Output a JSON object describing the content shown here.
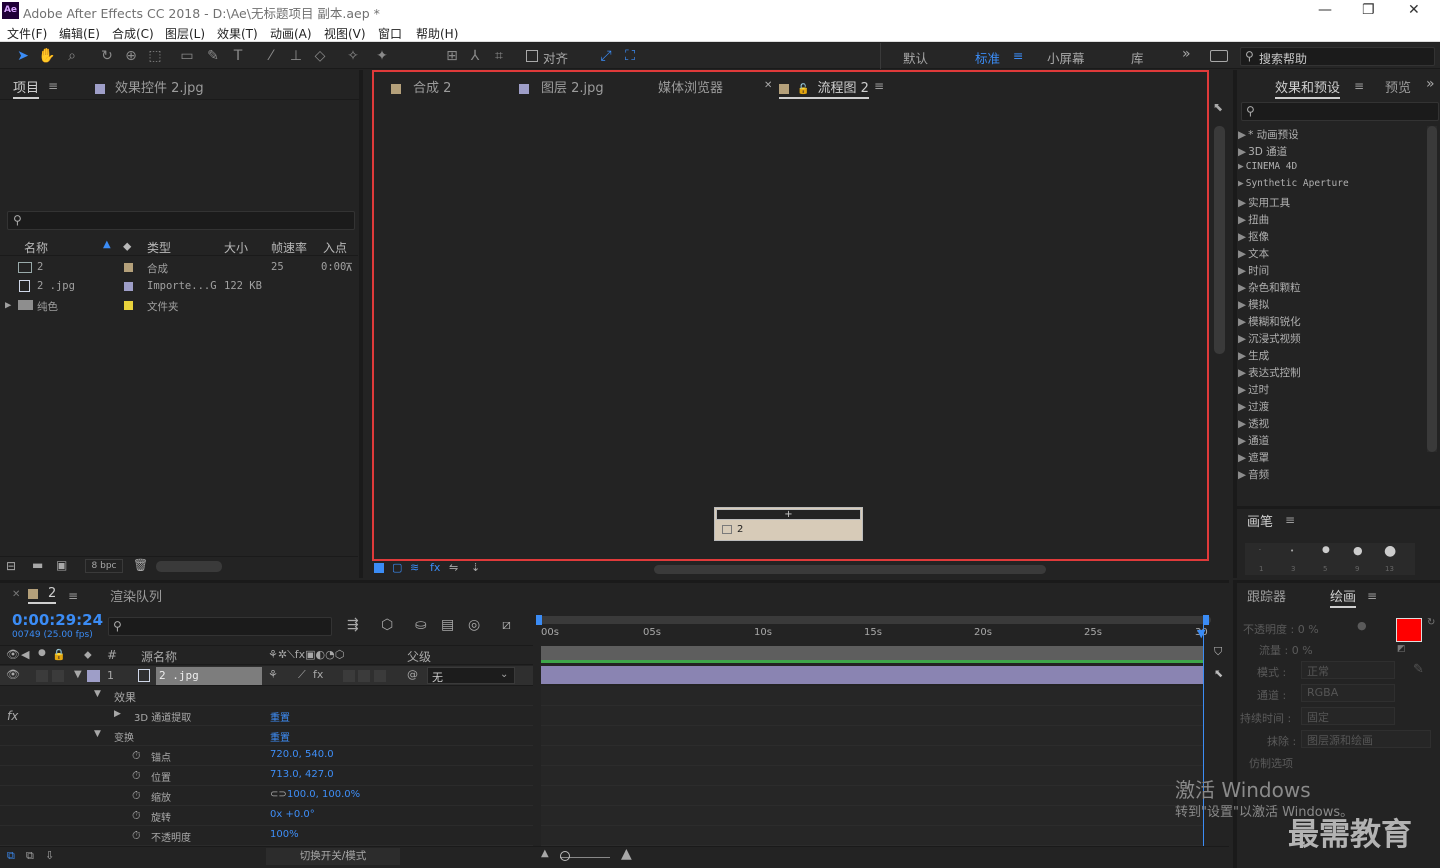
{
  "window": {
    "title": "Adobe After Effects CC 2018 - D:\\Ae\\无标题项目 副本.aep *",
    "logo": "Ae",
    "minimize": "—",
    "maximize": "❐",
    "close": "✕"
  },
  "menu": [
    "文件(F)",
    "编辑(E)",
    "合成(C)",
    "图层(L)",
    "效果(T)",
    "动画(A)",
    "视图(V)",
    "窗口",
    "帮助(H)"
  ],
  "toolbar": {
    "align_label": "对齐",
    "workspaces": [
      "默认",
      "标准",
      "小屏幕",
      "库"
    ],
    "search_help": "搜索帮助",
    "more": "»"
  },
  "project": {
    "tabs": [
      "项目",
      "效果控件 2.jpg"
    ],
    "columns": [
      "名称",
      "类型",
      "大小",
      "帧速率",
      "入点"
    ],
    "items": [
      {
        "name": "2",
        "type": "合成",
        "size": "",
        "fps": "25",
        "in": "0:00",
        "color": "#b4a07a"
      },
      {
        "name": "2 .jpg",
        "type": "Importe...G",
        "size": "122 KB",
        "fps": "",
        "in": "",
        "color": "#9e9ec8"
      },
      {
        "name": "纯色",
        "type": "文件夹",
        "size": "",
        "fps": "",
        "in": "",
        "color": "#e8d23c"
      }
    ],
    "bpc": "8 bpc"
  },
  "viewer": {
    "tabs": [
      "合成 2",
      "图层 2.jpg",
      "媒体浏览器",
      "流程图 2"
    ],
    "node_label": "2",
    "node_plus": "+",
    "highlight": "#e03a3a"
  },
  "effects": {
    "tabs": [
      "效果和预设",
      "预览"
    ],
    "items": [
      "* 动画预设",
      "3D 通道",
      "CINEMA 4D",
      "Synthetic Aperture",
      "实用工具",
      "扭曲",
      "抠像",
      "文本",
      "时间",
      "杂色和颗粒",
      "模拟",
      "模糊和锐化",
      "沉浸式视频",
      "生成",
      "表达式控制",
      "过时",
      "过渡",
      "透视",
      "通道",
      "遮罩",
      "音频"
    ],
    "brush_title": "画笔",
    "brush_sizes": [
      "1",
      "3",
      "5",
      "9",
      "13"
    ]
  },
  "timeline": {
    "tabs": [
      "2",
      "渲染队列"
    ],
    "timecode": "0:00:29:24",
    "frames": "00749 (25.00 fps)",
    "col_source": "源名称",
    "col_parent": "父级",
    "layer_num": "1",
    "layer_name": "2 .jpg",
    "parent_value": "无",
    "props": [
      {
        "name": "效果",
        "val": ""
      },
      {
        "name": "3D 通道提取",
        "val": "重置"
      },
      {
        "name": "变换",
        "val": "重置"
      },
      {
        "name": "锚点",
        "val": "720.0, 540.0"
      },
      {
        "name": "位置",
        "val": "713.0, 427.0"
      },
      {
        "name": "缩放",
        "val": "100.0, 100.0%"
      },
      {
        "name": "旋转",
        "val": "0x +0.0°"
      },
      {
        "name": "不透明度",
        "val": "100%"
      }
    ],
    "toggle": "切换开关/模式",
    "ruler": [
      "00s",
      "05s",
      "10s",
      "15s",
      "20s",
      "25s",
      "30"
    ]
  },
  "paint": {
    "tabs": [
      "跟踪器",
      "绘画"
    ],
    "opacity": "不透明度 : 0 %",
    "flow": "流量 : 0 %",
    "mode_label": "模式 :",
    "mode": "正常",
    "channel_label": "通道 :",
    "channel": "RGBA",
    "duration_label": "持续时间 :",
    "duration": "固定",
    "erase_label": "抹除 :",
    "erase": "图层源和绘画",
    "clone": "仿制选项",
    "fg": "#ff0000",
    "bg": "#ffffff"
  },
  "activation": {
    "line1": "激活 Windows",
    "line2": "转到\"设置\"以激活 Windows。"
  },
  "brand": "最需教育"
}
